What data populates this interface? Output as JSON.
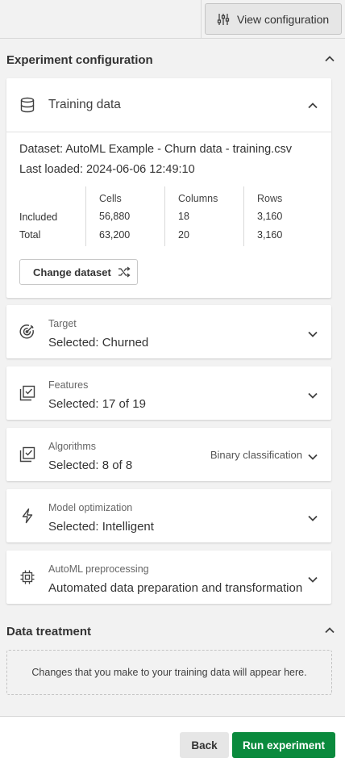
{
  "topbar": {
    "view_config_label": "View configuration"
  },
  "experiment_config": {
    "title": "Experiment configuration"
  },
  "training_data": {
    "title": "Training data",
    "dataset_line": "Dataset: AutoML Example - Churn data - training.csv",
    "last_loaded_line": "Last loaded: 2024-06-06 12:49:10",
    "row_labels": [
      "Included",
      "Total"
    ],
    "columns": [
      {
        "header": "Cells",
        "included": "56,880",
        "total": "63,200"
      },
      {
        "header": "Columns",
        "included": "18",
        "total": "20"
      },
      {
        "header": "Rows",
        "included": "3,160",
        "total": "3,160"
      }
    ],
    "change_dataset_label": "Change dataset"
  },
  "sections": [
    {
      "label": "Target",
      "value": "Selected: Churned",
      "right_label": ""
    },
    {
      "label": "Features",
      "value": "Selected: 17 of 19",
      "right_label": ""
    },
    {
      "label": "Algorithms",
      "value": "Selected: 8 of 8",
      "right_label": "Binary classification"
    },
    {
      "label": "Model optimization",
      "value": "Selected: Intelligent",
      "right_label": ""
    },
    {
      "label": "AutoML preprocessing",
      "value": "Automated data preparation and transformation",
      "right_label": ""
    }
  ],
  "data_treatment": {
    "title": "Data treatment",
    "placeholder": "Changes that you make to your training data will appear here."
  },
  "footer": {
    "back_label": "Back",
    "run_label": "Run experiment"
  },
  "colors": {
    "primary_green": "#0a8a3d",
    "background": "#f2f2f2",
    "card": "#ffffff"
  }
}
